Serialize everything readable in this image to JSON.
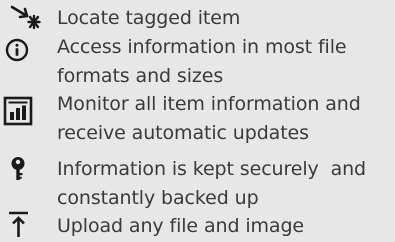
{
  "features": [
    {
      "icon": "locate-arrow-icon",
      "text": "Locate tagged item"
    },
    {
      "icon": "info-icon",
      "text": "Access information in most file formats and sizes"
    },
    {
      "icon": "monitor-chart-icon",
      "text": "Monitor all item information and receive automatic updates"
    },
    {
      "icon": "key-icon",
      "text": "Information is kept securely  and constantly backed up"
    },
    {
      "icon": "upload-icon",
      "text": "Upload any file and image"
    }
  ],
  "colors": {
    "background": "#e7e7e7",
    "text": "#3a3a3a",
    "icon": "#1a1a1a"
  }
}
